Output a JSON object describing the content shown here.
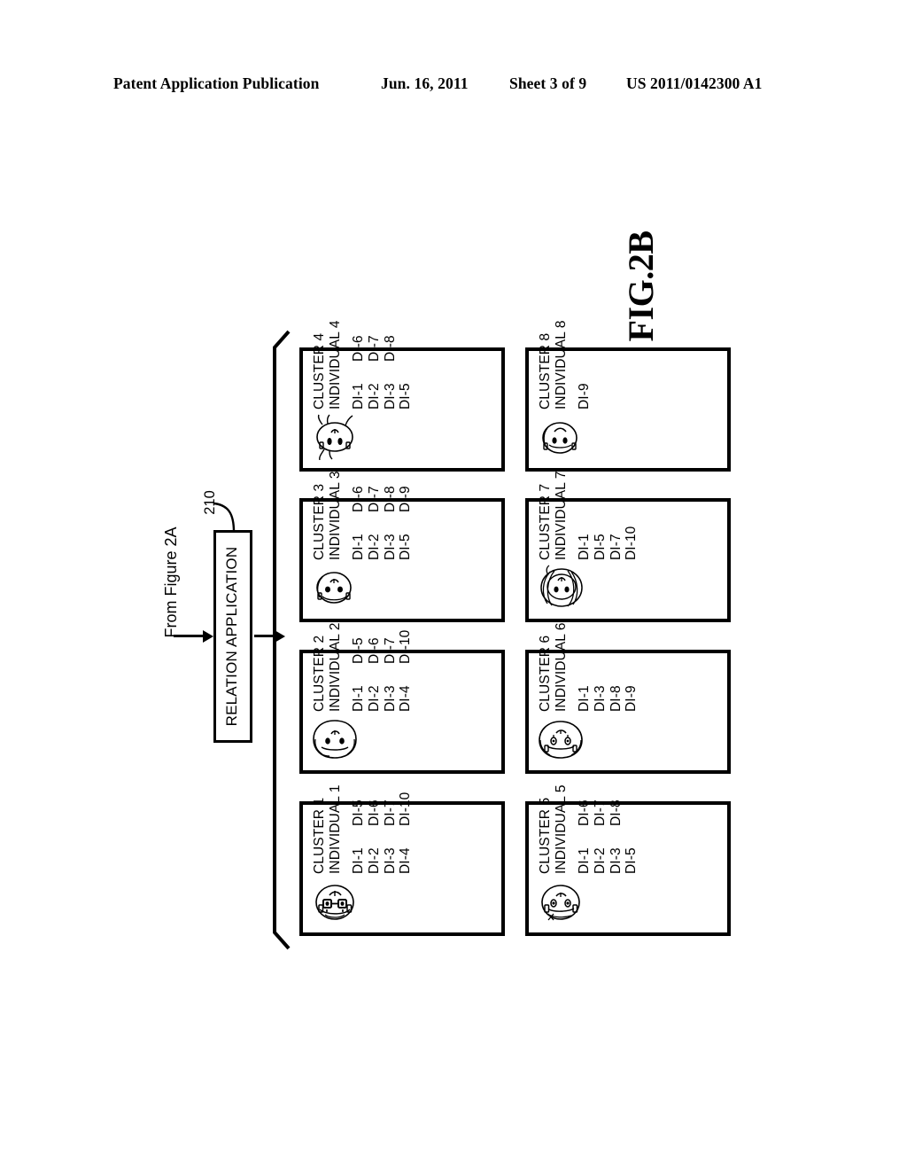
{
  "header": {
    "publication": "Patent Application Publication",
    "date": "Jun. 16, 2011",
    "sheet": "Sheet 3 of 9",
    "patent_number": "US 2011/0142300 A1"
  },
  "figure": {
    "label": "FIG.2B",
    "from_reference": "From Figure 2A",
    "reference_numeral": "210"
  },
  "relation_application": {
    "label": "RELATION APPLICATION"
  },
  "clusters": [
    {
      "id": "cluster-1",
      "title": "CLUSTER 1",
      "individual": "INDIVIDUAL 1",
      "face": "face-glasses",
      "di_col1": [
        "DI-1",
        "DI-2",
        "DI-3",
        "DI-4"
      ],
      "di_col2": [
        "DI-5",
        "DI-6",
        "DI-7",
        "DI-10"
      ]
    },
    {
      "id": "cluster-2",
      "title": "CLUSTER 2",
      "individual": "INDIVIDUAL 2",
      "face": "face-curly",
      "di_col1": [
        "DI-1",
        "DI-2",
        "DI-3",
        "DI-4"
      ],
      "di_col2": [
        "DI-5",
        "DI-6",
        "DI-7",
        "DI-10"
      ]
    },
    {
      "id": "cluster-3",
      "title": "CLUSTER 3",
      "individual": "INDIVIDUAL 3",
      "face": "face-plain",
      "di_col1": [
        "DI-1",
        "DI-2",
        "DI-3",
        "DI-5"
      ],
      "di_col2": [
        "DI-6",
        "DI-7",
        "DI-8",
        "DI-9"
      ]
    },
    {
      "id": "cluster-4",
      "title": "CLUSTER 4",
      "individual": "INDIVIDUAL 4",
      "face": "face-spiky",
      "di_col1": [
        "DI-1",
        "DI-2",
        "DI-3",
        "DI-5"
      ],
      "di_col2": [
        "DI-6",
        "DI-7",
        "DI-8"
      ]
    },
    {
      "id": "cluster-5",
      "title": "CLUSTER 5",
      "individual": "INDIVIDUAL 5",
      "face": "face-short-hair",
      "di_col1": [
        "DI-1",
        "DI-2",
        "DI-3",
        "DI-5"
      ],
      "di_col2": [
        "DI-6",
        "DI-7",
        "DI-8"
      ]
    },
    {
      "id": "cluster-6",
      "title": "CLUSTER 6",
      "individual": "INDIVIDUAL 6",
      "face": "face-wavy",
      "di_col1": [
        "DI-1",
        "DI-3",
        "DI-8",
        "DI-9"
      ],
      "di_col2": []
    },
    {
      "id": "cluster-7",
      "title": "CLUSTER 7",
      "individual": "INDIVIDUAL 7",
      "face": "face-long-hair",
      "di_col1": [
        "DI-1",
        "DI-5",
        "DI-7",
        "DI-10"
      ],
      "di_col2": []
    },
    {
      "id": "cluster-8",
      "title": "CLUSTER 8",
      "individual": "INDIVIDUAL 8",
      "face": "face-oval",
      "di_col1": [
        "DI-9"
      ],
      "di_col2": []
    }
  ],
  "colors": {
    "ink": "#000000",
    "paper": "#ffffff"
  }
}
